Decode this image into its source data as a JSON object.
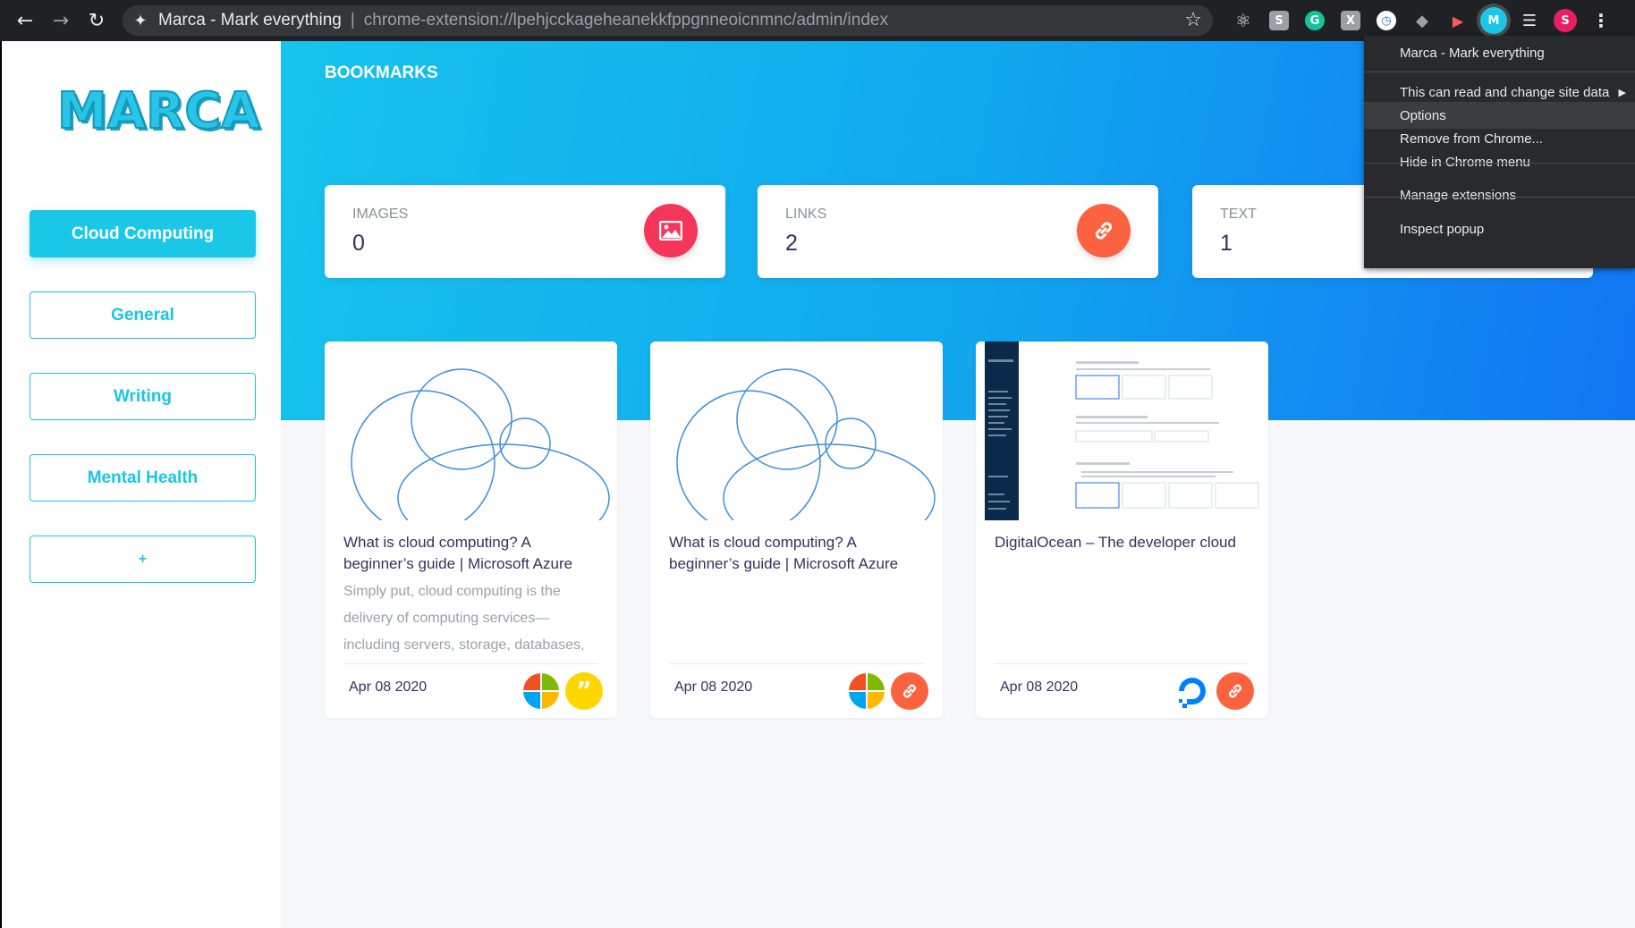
{
  "browser": {
    "tab_title": "Marca - Mark everything",
    "url": "chrome-extension://lpehjcckageheanekkfppgnneoicnmnc/admin/index",
    "profile_initial": "S",
    "icons": [
      "back-icon",
      "forward-icon",
      "reload-icon",
      "puzzle-icon",
      "star-icon",
      "react-icon",
      "s-extension-icon",
      "grammarly-icon",
      "x-extension-icon",
      "clock-icon",
      "layers-icon",
      "video-icon",
      "marca-icon",
      "reading-list-icon",
      "avatar",
      "kebab-menu-icon"
    ]
  },
  "sidebar": {
    "logo": "MARCA",
    "categories": [
      {
        "label": "Cloud Computing",
        "active": true
      },
      {
        "label": "General",
        "active": false
      },
      {
        "label": "Writing",
        "active": false
      },
      {
        "label": "Mental Health",
        "active": false
      },
      {
        "label": "+",
        "active": false
      }
    ]
  },
  "main": {
    "title": "BOOKMARKS",
    "stats": [
      {
        "label": "IMAGES",
        "value": "0",
        "icon": "image-icon",
        "color": "#f5365c"
      },
      {
        "label": "LINKS",
        "value": "2",
        "icon": "link-icon",
        "color": "#fb6340"
      },
      {
        "label": "TEXT",
        "value": "1",
        "icon": "quote-icon",
        "color": "#ffd600"
      }
    ],
    "cards": [
      {
        "title": "What is cloud computing? A beginner’s guide | Microsoft Azure",
        "description": "Simply put, cloud computing is the delivery of computing services—including servers, storage, databases, networking, software, analytics, and intelligence",
        "date": "Apr 08 2020",
        "icons": [
          "microsoft-icon",
          "quote-icon"
        ]
      },
      {
        "title": "What is cloud computing? A beginner’s guide | Microsoft Azure",
        "description": "",
        "date": "Apr 08 2020",
        "icons": [
          "microsoft-icon",
          "link-icon"
        ]
      },
      {
        "title": "DigitalOcean – The developer cloud",
        "description": "",
        "date": "Apr 08 2020",
        "icons": [
          "digitalocean-icon",
          "link-icon"
        ]
      }
    ]
  },
  "context_menu": {
    "header": "Marca - Mark everything",
    "items": [
      {
        "label": "This can read and change site data",
        "submenu": true
      },
      {
        "label": "Options",
        "hover": true
      },
      {
        "label": "Remove from Chrome..."
      },
      {
        "label": "Hide in Chrome menu"
      },
      {
        "label": "Manage extensions"
      },
      {
        "label": "Inspect popup"
      }
    ]
  },
  "colors": {
    "accent": "#1ac7e6",
    "hero_start": "#17c3ec",
    "hero_end": "#1275f2",
    "text_dark": "#32325d",
    "link_orange": "#fb6340",
    "image_red": "#f5365c",
    "quote_yellow": "#ffd600"
  }
}
